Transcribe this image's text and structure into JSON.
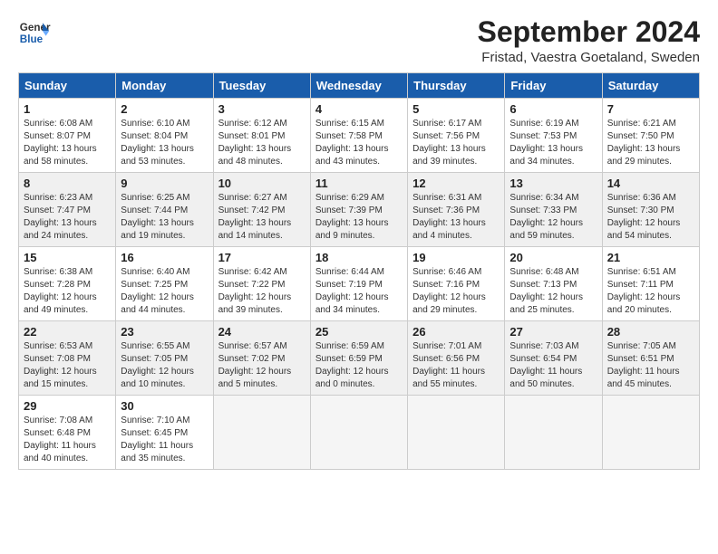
{
  "logo": {
    "line1": "General",
    "line2": "Blue"
  },
  "title": "September 2024",
  "subtitle": "Fristad, Vaestra Goetaland, Sweden",
  "weekdays": [
    "Sunday",
    "Monday",
    "Tuesday",
    "Wednesday",
    "Thursday",
    "Friday",
    "Saturday"
  ],
  "weeks": [
    [
      {
        "day": "1",
        "info": "Sunrise: 6:08 AM\nSunset: 8:07 PM\nDaylight: 13 hours\nand 58 minutes."
      },
      {
        "day": "2",
        "info": "Sunrise: 6:10 AM\nSunset: 8:04 PM\nDaylight: 13 hours\nand 53 minutes."
      },
      {
        "day": "3",
        "info": "Sunrise: 6:12 AM\nSunset: 8:01 PM\nDaylight: 13 hours\nand 48 minutes."
      },
      {
        "day": "4",
        "info": "Sunrise: 6:15 AM\nSunset: 7:58 PM\nDaylight: 13 hours\nand 43 minutes."
      },
      {
        "day": "5",
        "info": "Sunrise: 6:17 AM\nSunset: 7:56 PM\nDaylight: 13 hours\nand 39 minutes."
      },
      {
        "day": "6",
        "info": "Sunrise: 6:19 AM\nSunset: 7:53 PM\nDaylight: 13 hours\nand 34 minutes."
      },
      {
        "day": "7",
        "info": "Sunrise: 6:21 AM\nSunset: 7:50 PM\nDaylight: 13 hours\nand 29 minutes."
      }
    ],
    [
      {
        "day": "8",
        "info": "Sunrise: 6:23 AM\nSunset: 7:47 PM\nDaylight: 13 hours\nand 24 minutes."
      },
      {
        "day": "9",
        "info": "Sunrise: 6:25 AM\nSunset: 7:44 PM\nDaylight: 13 hours\nand 19 minutes."
      },
      {
        "day": "10",
        "info": "Sunrise: 6:27 AM\nSunset: 7:42 PM\nDaylight: 13 hours\nand 14 minutes."
      },
      {
        "day": "11",
        "info": "Sunrise: 6:29 AM\nSunset: 7:39 PM\nDaylight: 13 hours\nand 9 minutes."
      },
      {
        "day": "12",
        "info": "Sunrise: 6:31 AM\nSunset: 7:36 PM\nDaylight: 13 hours\nand 4 minutes."
      },
      {
        "day": "13",
        "info": "Sunrise: 6:34 AM\nSunset: 7:33 PM\nDaylight: 12 hours\nand 59 minutes."
      },
      {
        "day": "14",
        "info": "Sunrise: 6:36 AM\nSunset: 7:30 PM\nDaylight: 12 hours\nand 54 minutes."
      }
    ],
    [
      {
        "day": "15",
        "info": "Sunrise: 6:38 AM\nSunset: 7:28 PM\nDaylight: 12 hours\nand 49 minutes."
      },
      {
        "day": "16",
        "info": "Sunrise: 6:40 AM\nSunset: 7:25 PM\nDaylight: 12 hours\nand 44 minutes."
      },
      {
        "day": "17",
        "info": "Sunrise: 6:42 AM\nSunset: 7:22 PM\nDaylight: 12 hours\nand 39 minutes."
      },
      {
        "day": "18",
        "info": "Sunrise: 6:44 AM\nSunset: 7:19 PM\nDaylight: 12 hours\nand 34 minutes."
      },
      {
        "day": "19",
        "info": "Sunrise: 6:46 AM\nSunset: 7:16 PM\nDaylight: 12 hours\nand 29 minutes."
      },
      {
        "day": "20",
        "info": "Sunrise: 6:48 AM\nSunset: 7:13 PM\nDaylight: 12 hours\nand 25 minutes."
      },
      {
        "day": "21",
        "info": "Sunrise: 6:51 AM\nSunset: 7:11 PM\nDaylight: 12 hours\nand 20 minutes."
      }
    ],
    [
      {
        "day": "22",
        "info": "Sunrise: 6:53 AM\nSunset: 7:08 PM\nDaylight: 12 hours\nand 15 minutes."
      },
      {
        "day": "23",
        "info": "Sunrise: 6:55 AM\nSunset: 7:05 PM\nDaylight: 12 hours\nand 10 minutes."
      },
      {
        "day": "24",
        "info": "Sunrise: 6:57 AM\nSunset: 7:02 PM\nDaylight: 12 hours\nand 5 minutes."
      },
      {
        "day": "25",
        "info": "Sunrise: 6:59 AM\nSunset: 6:59 PM\nDaylight: 12 hours\nand 0 minutes."
      },
      {
        "day": "26",
        "info": "Sunrise: 7:01 AM\nSunset: 6:56 PM\nDaylight: 11 hours\nand 55 minutes."
      },
      {
        "day": "27",
        "info": "Sunrise: 7:03 AM\nSunset: 6:54 PM\nDaylight: 11 hours\nand 50 minutes."
      },
      {
        "day": "28",
        "info": "Sunrise: 7:05 AM\nSunset: 6:51 PM\nDaylight: 11 hours\nand 45 minutes."
      }
    ],
    [
      {
        "day": "29",
        "info": "Sunrise: 7:08 AM\nSunset: 6:48 PM\nDaylight: 11 hours\nand 40 minutes."
      },
      {
        "day": "30",
        "info": "Sunrise: 7:10 AM\nSunset: 6:45 PM\nDaylight: 11 hours\nand 35 minutes."
      },
      {
        "day": "",
        "info": ""
      },
      {
        "day": "",
        "info": ""
      },
      {
        "day": "",
        "info": ""
      },
      {
        "day": "",
        "info": ""
      },
      {
        "day": "",
        "info": ""
      }
    ]
  ]
}
